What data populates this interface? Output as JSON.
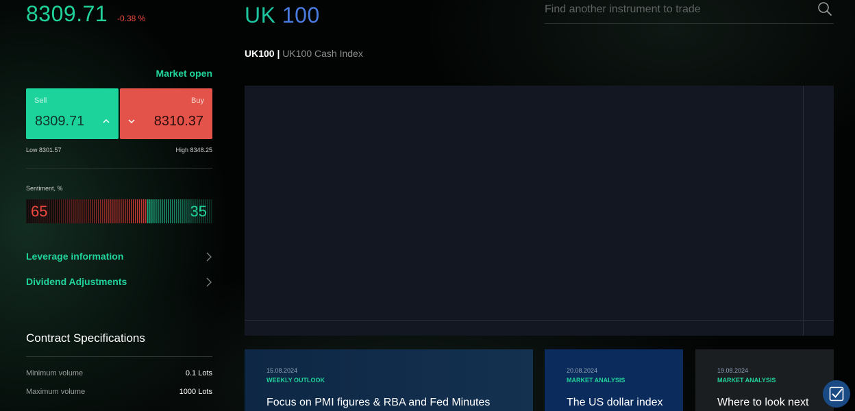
{
  "quote": {
    "price": "8309.71",
    "change": "-0.38 %",
    "market_status": "Market open",
    "sell_label": "Sell",
    "sell_price": "8309.71",
    "buy_label": "Buy",
    "buy_price": "8310.37",
    "low": "Low 8301.57",
    "high": "High 8348.25"
  },
  "sentiment": {
    "label": "Sentiment, %",
    "sell_percent": 65,
    "buy_percent": 35,
    "sell_text": "65",
    "buy_text": "35",
    "sell_color": "#f0473f",
    "buy_color": "#21d39b"
  },
  "links": [
    {
      "label": "Leverage information",
      "icon": "chevron-right-icon"
    },
    {
      "label": "Dividend Adjustments",
      "icon": "chevron-right-icon"
    }
  ],
  "contract_specs": {
    "title": "Contract Specifications",
    "rows": [
      {
        "key": "Minimum volume",
        "value": "0.1 Lots"
      },
      {
        "key": "Maximum volume",
        "value": "1000 Lots"
      }
    ]
  },
  "instrument": {
    "title_part1": "UK",
    "title_part2": "100",
    "symbol": "UK100",
    "separator": "|",
    "description": "UK100 Cash Index"
  },
  "search": {
    "placeholder": "Find another instrument to trade",
    "icon": "search-icon"
  },
  "news": [
    {
      "date": "15.08.2024",
      "category": "WEEKLY OUTLOOK",
      "headline": "Focus on PMI figures & RBA and Fed Minutes"
    },
    {
      "date": "20.08.2024",
      "category": "MARKET ANALYSIS",
      "headline": "The US dollar index"
    },
    {
      "date": "19.08.2024",
      "category": "MARKET ANALYSIS",
      "headline": "Where to look next"
    }
  ],
  "colors": {
    "accent_green": "#21d39b",
    "accent_red": "#f0473f",
    "chart_bg": "#131722"
  },
  "chat": {
    "icon": "chat-check-icon"
  }
}
